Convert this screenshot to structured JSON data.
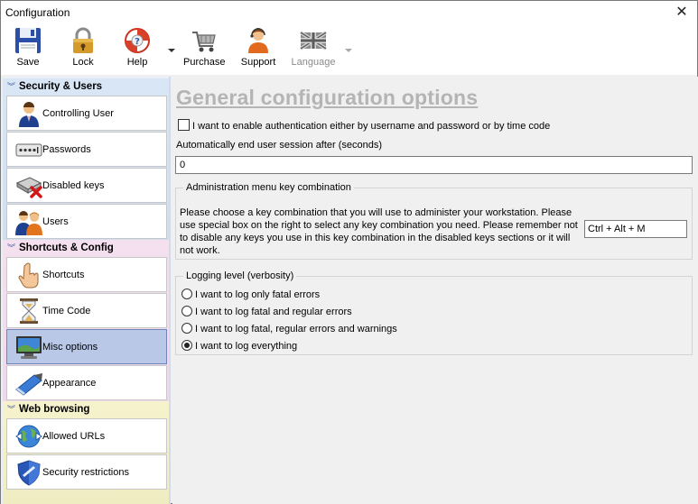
{
  "window": {
    "title": "Configuration"
  },
  "toolbar": {
    "save": "Save",
    "lock": "Lock",
    "help": "Help",
    "purchase": "Purchase",
    "support": "Support",
    "language": "Language"
  },
  "sidebar": {
    "groups": [
      {
        "title": "Security & Users",
        "items": [
          {
            "label": "Controlling User",
            "icon": "user-icon"
          },
          {
            "label": "Passwords",
            "icon": "password-icon"
          },
          {
            "label": "Disabled keys",
            "icon": "disabled-keys-icon"
          },
          {
            "label": "Users",
            "icon": "users-icon"
          }
        ]
      },
      {
        "title": "Shortcuts & Config",
        "items": [
          {
            "label": "Shortcuts",
            "icon": "hand-icon"
          },
          {
            "label": "Time Code",
            "icon": "hourglass-icon"
          },
          {
            "label": "Misc options",
            "icon": "monitor-icon",
            "selected": true
          },
          {
            "label": "Appearance",
            "icon": "paint-icon"
          }
        ]
      },
      {
        "title": "Web browsing",
        "items": [
          {
            "label": "Allowed URLs",
            "icon": "globe-icon"
          },
          {
            "label": "Security restrictions",
            "icon": "shield-icon"
          }
        ]
      }
    ]
  },
  "main": {
    "title": "General configuration options",
    "auth_checkbox_label": "I want to enable authentication either by username and password or by time code",
    "auth_checked": false,
    "session_label": "Automatically end user session after (seconds)",
    "session_value": "0",
    "admin": {
      "legend": "Administration menu key combination",
      "description": "Please choose a key combination that you will use to administer your workstation. Please use special box on the right to select any key combination you need. Please remember not to disable any keys you use in this key combination in the disabled keys sections or it will not work.",
      "key_value": "Ctrl + Alt + M"
    },
    "logging": {
      "legend": "Logging level (verbosity)",
      "options": [
        {
          "label": "I want to log only fatal errors",
          "checked": false
        },
        {
          "label": "I want to log fatal and regular errors",
          "checked": false
        },
        {
          "label": "I want to log fatal, regular errors and warnings",
          "checked": false
        },
        {
          "label": "I want to log everything",
          "checked": true
        }
      ]
    }
  },
  "colors": {
    "selected_item": "#b9c8e6",
    "title_gray": "#b4b4b4"
  }
}
